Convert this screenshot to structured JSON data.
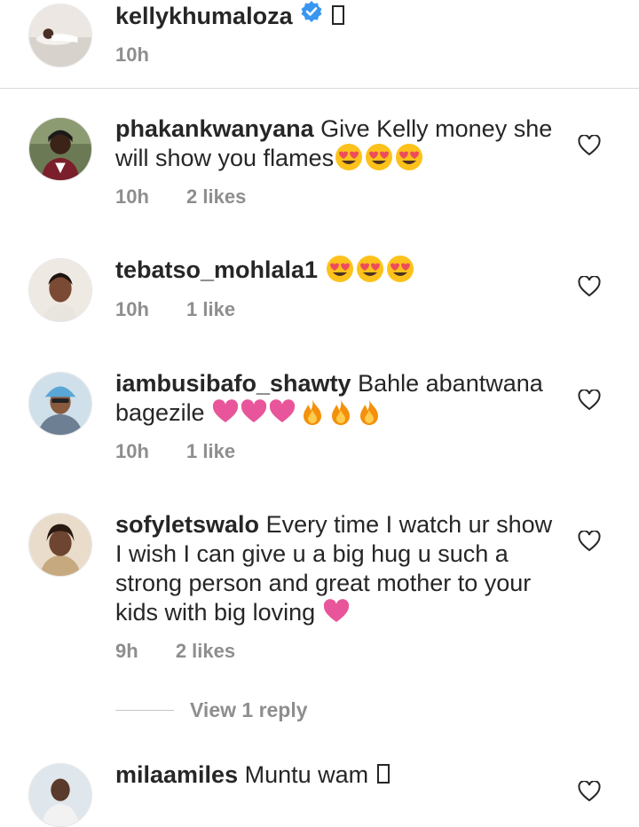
{
  "caption": {
    "username": "kellykhumaloza",
    "time": "10h",
    "icons": [
      "verified-badge-icon",
      "missing-glyph-icon"
    ]
  },
  "comments": [
    {
      "username": "phakankwanyana",
      "text": "Give Kelly money she will show you flames",
      "emojis": [
        "heart-eyes-emoji",
        "heart-eyes-emoji",
        "heart-eyes-emoji"
      ],
      "time": "10h",
      "likes": "2 likes"
    },
    {
      "username": "tebatso_mohlala1",
      "text": "",
      "emojis": [
        "heart-eyes-emoji",
        "heart-eyes-emoji",
        "heart-eyes-emoji"
      ],
      "time": "10h",
      "likes": "1 like"
    },
    {
      "username": "iambusibafo_shawty",
      "text": "Bahle abantwana bagezile",
      "emojis": [
        "pink-heart-emoji",
        "pink-heart-emoji",
        "pink-heart-emoji",
        "fire-emoji",
        "fire-emoji",
        "fire-emoji"
      ],
      "time": "10h",
      "likes": "1 like"
    },
    {
      "username": "sofyletswalo",
      "text": "Every time I watch ur show I wish I can give u a big hug u such a strong person and great mother to your kids with big loving",
      "emojis": [
        "pink-heart-emoji"
      ],
      "time": "9h",
      "likes": "2 likes",
      "view_replies": "View 1 reply"
    },
    {
      "username": "milaamiles",
      "text": "Muntu wam",
      "emojis": [
        "missing-glyph-icon"
      ]
    }
  ],
  "colors": {
    "text": "#262626",
    "secondary": "#8e8e8e",
    "divider": "#dbdbdb",
    "verified": "#3897f0",
    "heart_emoji": "#e8559a"
  }
}
